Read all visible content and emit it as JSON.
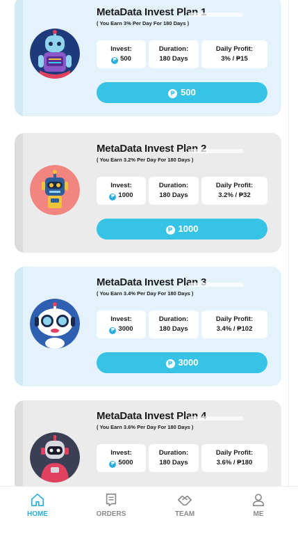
{
  "plans": [
    {
      "title": "MetaData Invest Plan 1",
      "subtitle": "( You Earn 3% Per Day For 180 Days )",
      "invest_label": "Invest:",
      "invest_value": "500",
      "duration_label": "Duration:",
      "duration_value": "180 Days",
      "profit_label": "Daily Profit:",
      "profit_value": "3% / ₱15",
      "button_label": "500",
      "color": "#e3f2fb"
    },
    {
      "title": "MetaData Invest Plan 2",
      "subtitle": "( You Earn 3.2% Per Day For 180 Days )",
      "invest_label": "Invest:",
      "invest_value": "1000",
      "duration_label": "Duration:",
      "duration_value": "180 Days",
      "profit_label": "Daily Profit:",
      "profit_value": "3.2% / ₱32",
      "button_label": "1000",
      "color": "#ebebeb"
    },
    {
      "title": "MetaData Invest Plan 3",
      "subtitle": "( You Earn 3.4% Per Day For 180 Days )",
      "invest_label": "Invest:",
      "invest_value": "3000",
      "duration_label": "Duration:",
      "duration_value": "180 Days",
      "profit_label": "Daily Profit:",
      "profit_value": "3.4% / ₱102",
      "button_label": "3000",
      "color": "#e3f2fb"
    },
    {
      "title": "MetaData Invest Plan 4",
      "subtitle": "( You Earn 3.6% Per Day For 180 Days )",
      "invest_label": "Invest:",
      "invest_value": "5000",
      "duration_label": "Duration:",
      "duration_value": "180 Days",
      "profit_label": "Daily Profit:",
      "profit_value": "3.6% / ₱180",
      "button_label": "5000",
      "color": "#ebebeb"
    }
  ],
  "currency_symbol": "₱",
  "tabs": [
    {
      "label": "HOME",
      "icon": "home-icon",
      "active": true
    },
    {
      "label": "ORDERS",
      "icon": "orders-icon",
      "active": false
    },
    {
      "label": "TEAM",
      "icon": "team-icon",
      "active": false
    },
    {
      "label": "ME",
      "icon": "user-icon",
      "active": false
    }
  ],
  "colors": {
    "accent": "#36c3e6",
    "active_tab": "#2aaee0",
    "inactive_tab": "#8a8a8a"
  }
}
